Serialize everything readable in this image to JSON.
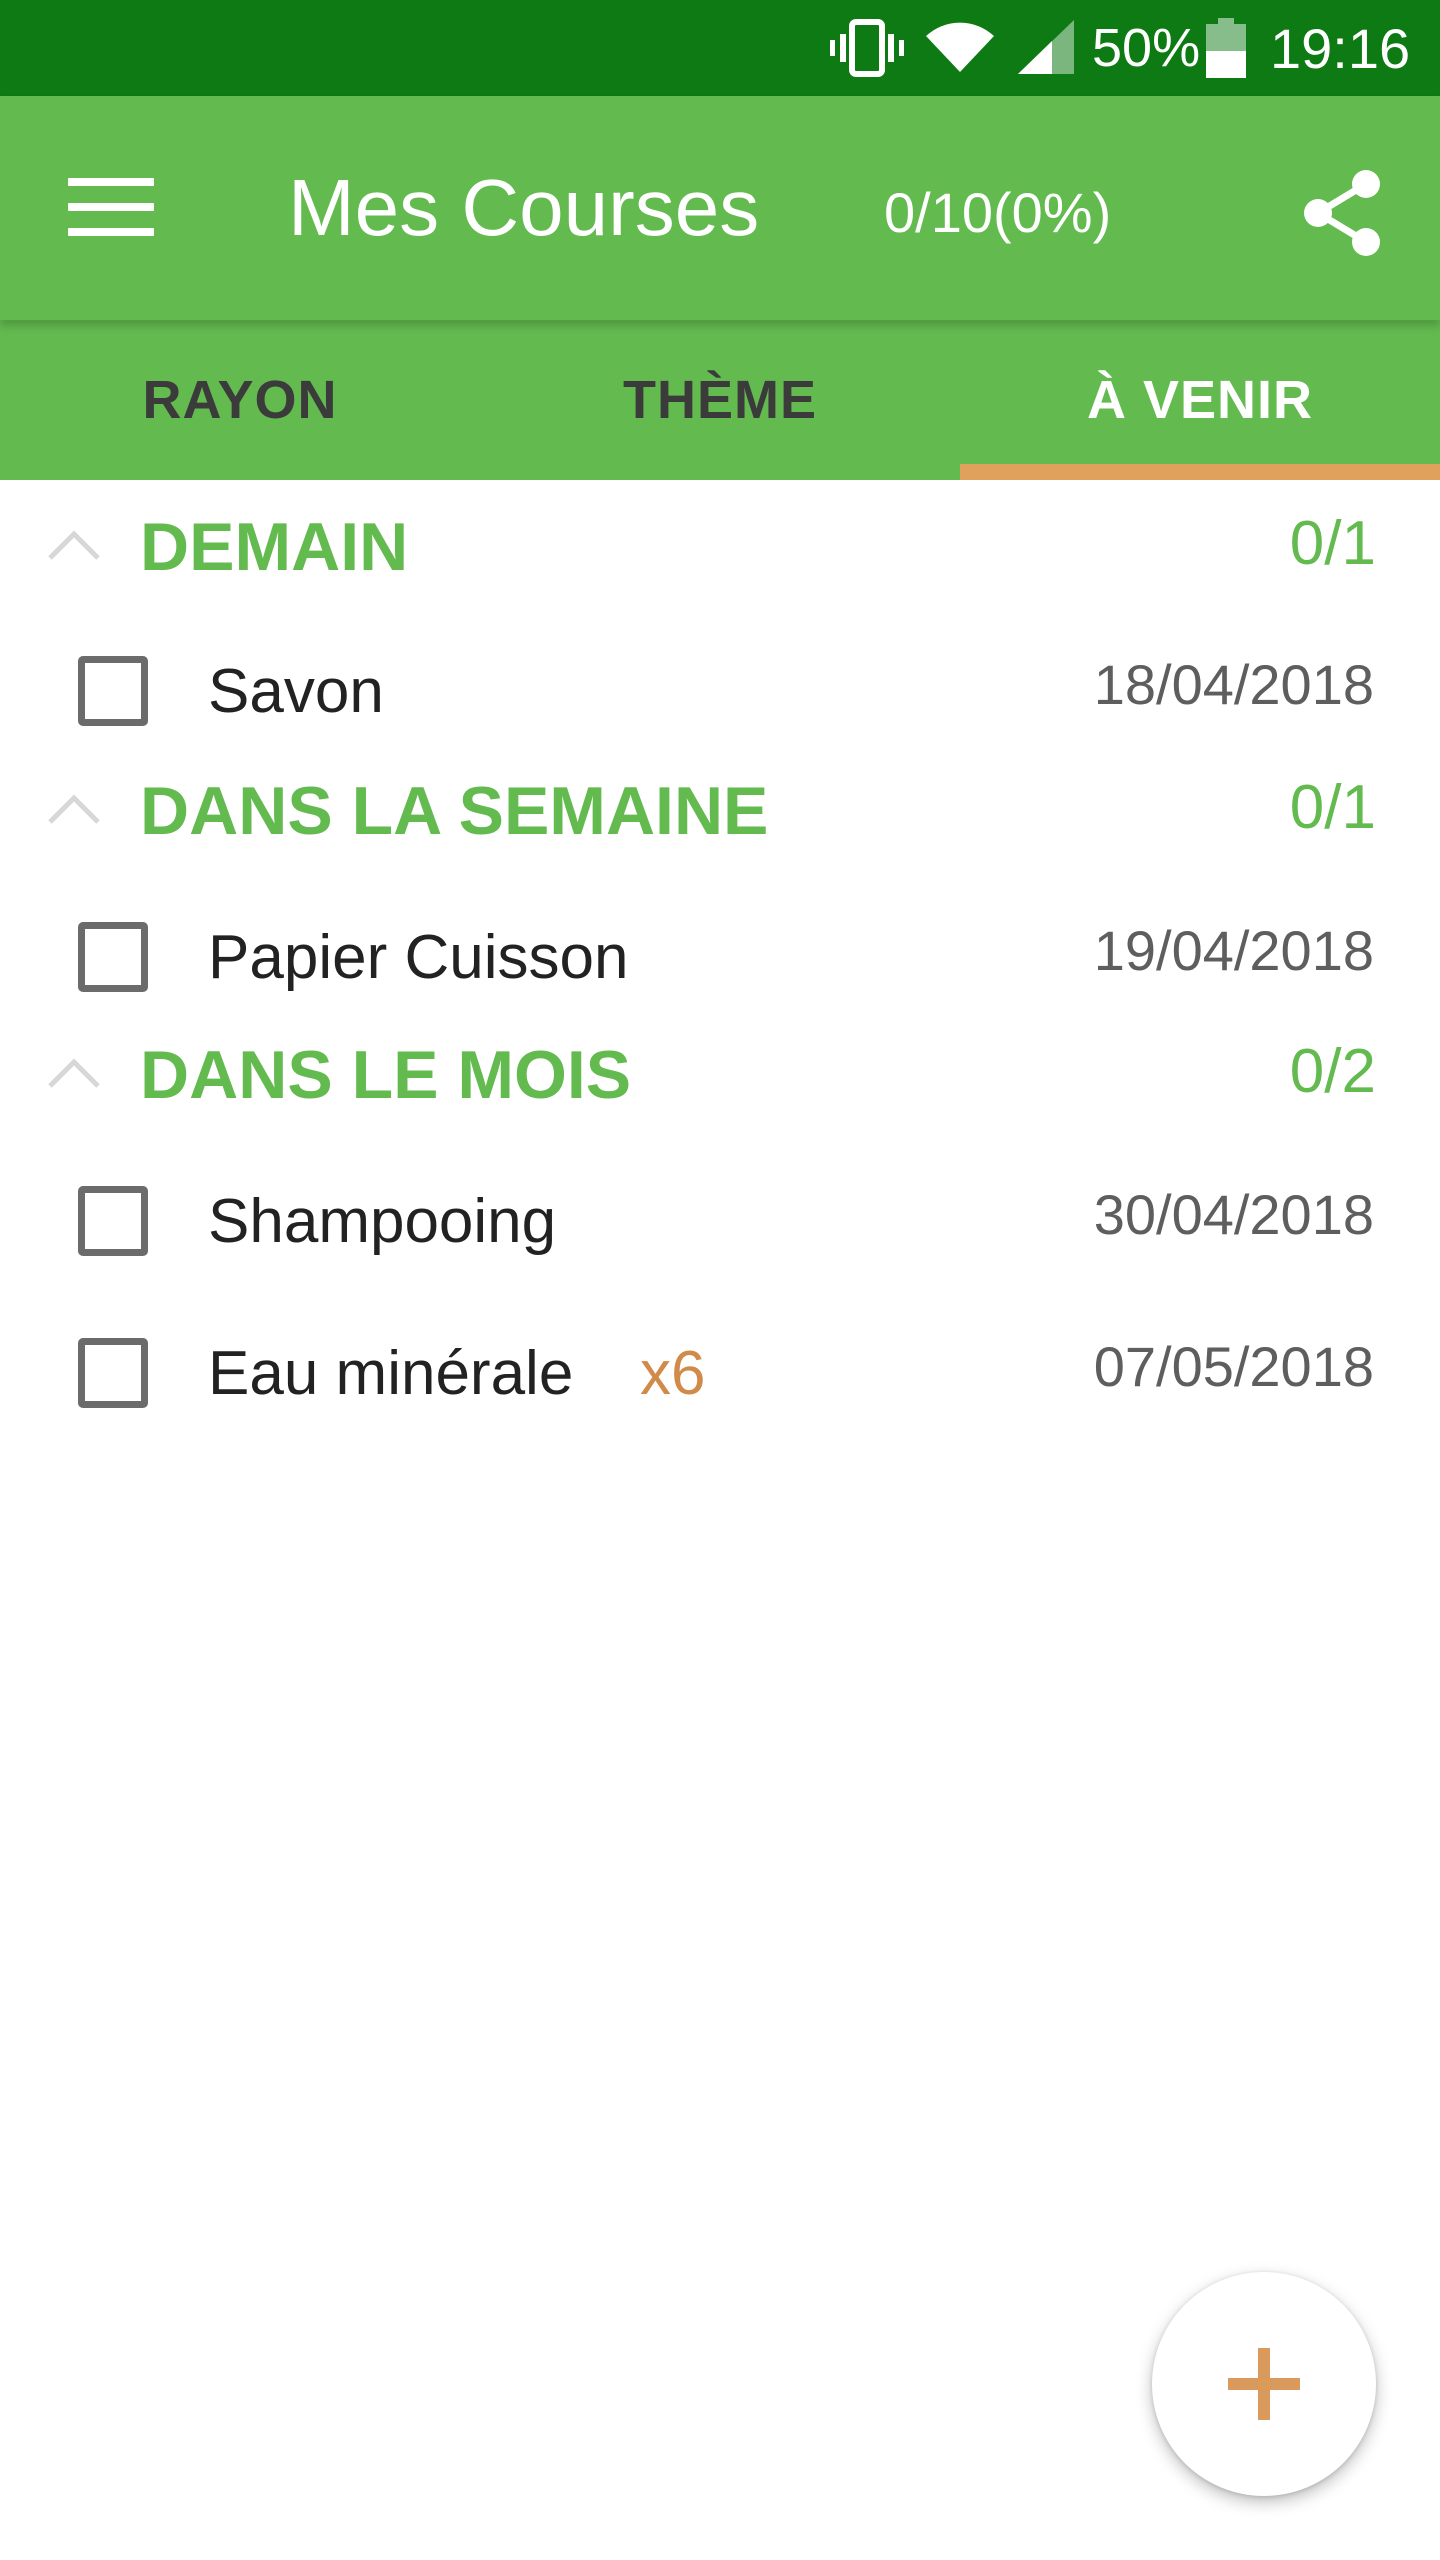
{
  "status_bar": {
    "battery_percent": "50%",
    "time": "19:16",
    "icons": [
      "vibrate-icon",
      "wifi-icon",
      "signal-icon",
      "battery-icon"
    ]
  },
  "app_bar": {
    "title": "Mes Courses",
    "progress": "0/10(0%)",
    "menu_icon": "hamburger-menu-icon",
    "share_icon": "share-icon"
  },
  "tabs": [
    {
      "label": "RAYON",
      "active": false
    },
    {
      "label": "THÈME",
      "active": false
    },
    {
      "label": "À VENIR",
      "active": true
    }
  ],
  "sections": [
    {
      "title": "DEMAIN",
      "count": "0/1",
      "items": [
        {
          "name": "Savon",
          "qty": "",
          "date": "18/04/2018",
          "checked": false
        }
      ]
    },
    {
      "title": "DANS LA SEMAINE",
      "count": "0/1",
      "items": [
        {
          "name": "Papier Cuisson",
          "qty": "",
          "date": "19/04/2018",
          "checked": false
        }
      ]
    },
    {
      "title": "DANS LE MOIS",
      "count": "0/2",
      "items": [
        {
          "name": "Shampooing",
          "qty": "",
          "date": "30/04/2018",
          "checked": false
        },
        {
          "name": "Eau minérale",
          "qty": "x6",
          "date": "07/05/2018",
          "checked": false
        }
      ]
    }
  ],
  "colors": {
    "status_bar": "#0d7a14",
    "primary": "#63ba4f",
    "accent": "#e0a15c",
    "quantity": "#d08a4a"
  },
  "fab": {
    "icon": "plus-icon"
  }
}
